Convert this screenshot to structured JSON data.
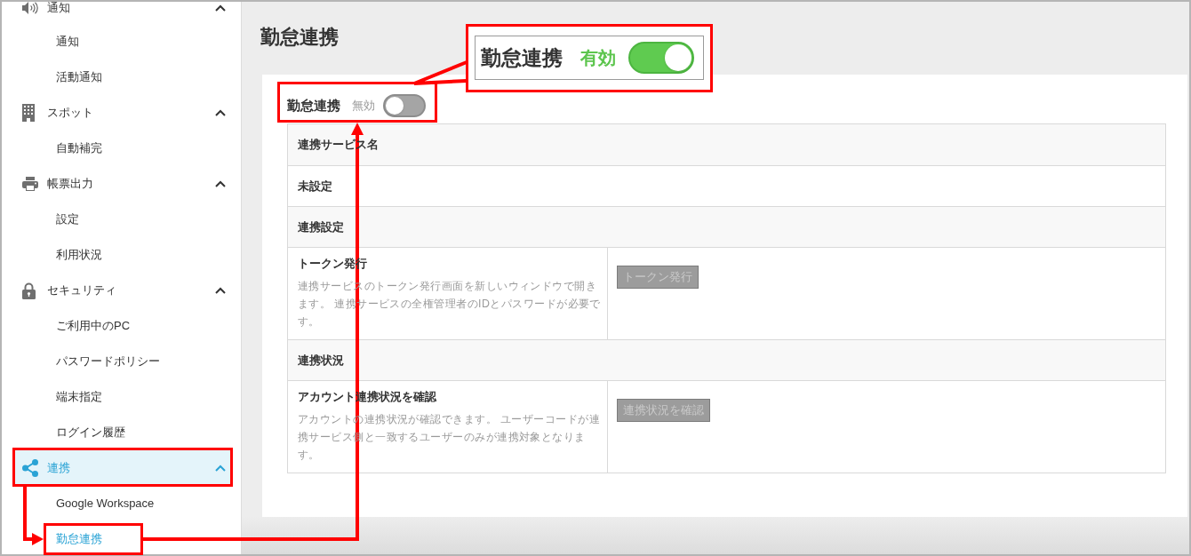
{
  "sidebar": {
    "groups": [
      {
        "label": "通知",
        "expanded": true,
        "selected": false,
        "children": [
          {
            "label": "通知",
            "selected": false
          },
          {
            "label": "活動通知",
            "selected": false
          }
        ]
      },
      {
        "label": "スポット",
        "expanded": true,
        "selected": false,
        "children": [
          {
            "label": "自動補完",
            "selected": false
          }
        ]
      },
      {
        "label": "帳票出力",
        "expanded": true,
        "selected": false,
        "children": [
          {
            "label": "設定",
            "selected": false
          },
          {
            "label": "利用状況",
            "selected": false
          }
        ]
      },
      {
        "label": "セキュリティ",
        "expanded": true,
        "selected": false,
        "children": [
          {
            "label": "ご利用中のPC",
            "selected": false
          },
          {
            "label": "パスワードポリシー",
            "selected": false
          },
          {
            "label": "端末指定",
            "selected": false
          },
          {
            "label": "ログイン履歴",
            "selected": false
          }
        ]
      },
      {
        "label": "連携",
        "expanded": true,
        "selected": true,
        "children": [
          {
            "label": "Google Workspace",
            "selected": false
          },
          {
            "label": "勤怠連携",
            "selected": true
          }
        ]
      }
    ]
  },
  "page": {
    "title": "勤怠連携"
  },
  "settings": {
    "toggle": {
      "label": "勤怠連携",
      "state_text": "無効",
      "on": false
    },
    "table": {
      "rows": [
        {
          "kind": "heading",
          "label": "連携サービス名"
        },
        {
          "kind": "value",
          "label": "未設定"
        },
        {
          "kind": "heading",
          "label": "連携設定"
        },
        {
          "kind": "action",
          "title": "トークン発行",
          "description": "連携サービスのトークン発行画面を新しいウィンドウで開きます。 連携サービスの全権管理者のIDとパスワードが必要です。",
          "button": {
            "label": "トークン発行",
            "disabled": true
          }
        },
        {
          "kind": "heading",
          "label": "連携状況"
        },
        {
          "kind": "action",
          "title": "アカウント連携状況を確認",
          "description": "アカウントの連携状況が確認できます。 ユーザーコードが連携サービス側と一致するユーザーのみが連携対象となります。",
          "button": {
            "label": "連携状況を確認",
            "disabled": true
          }
        }
      ]
    }
  },
  "callout": {
    "label": "勤怠連携",
    "state_text": "有効",
    "on": true
  }
}
